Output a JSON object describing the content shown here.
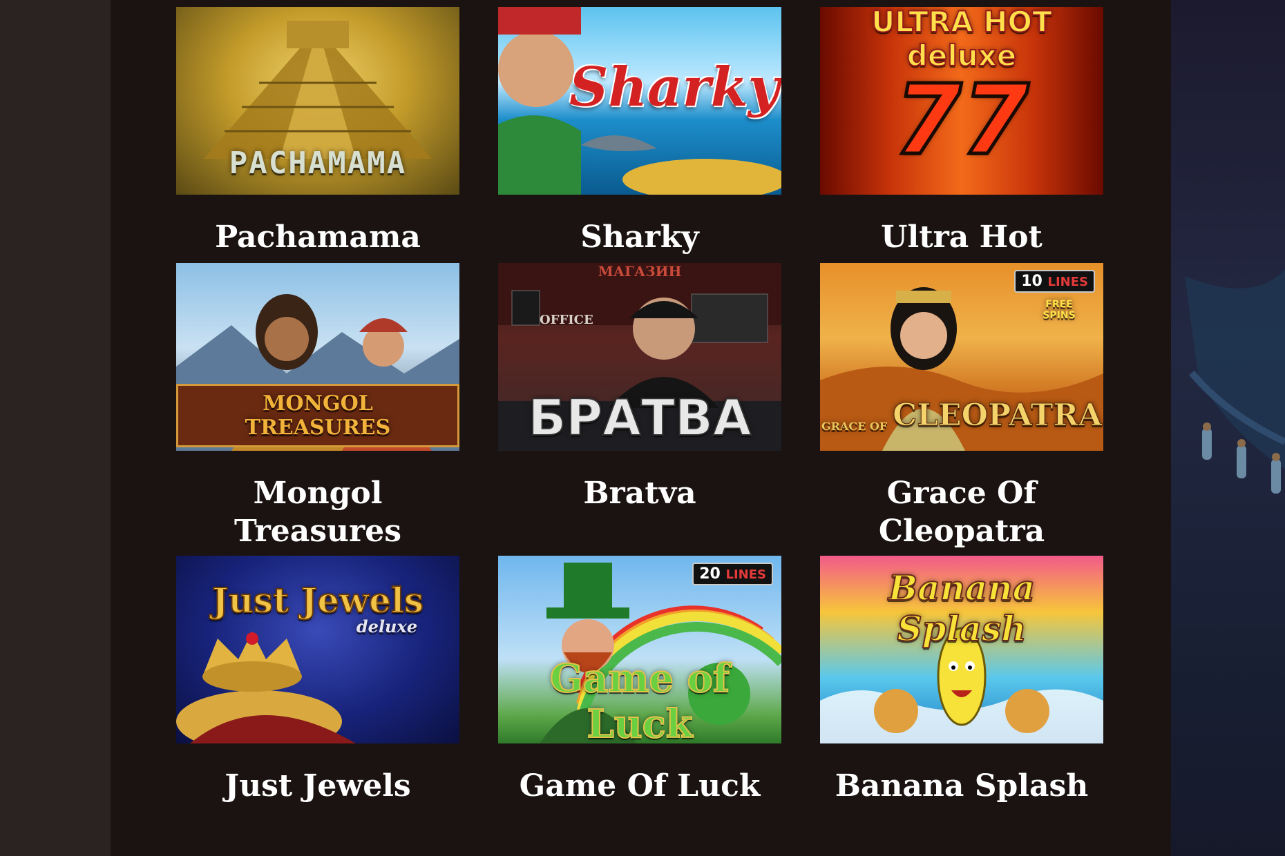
{
  "games": [
    {
      "title": "Pachamama",
      "logo": "PACHAMAMA",
      "theme": "pyramid"
    },
    {
      "title": "Sharky",
      "logo": "Sharky",
      "theme": "sea"
    },
    {
      "title": "Ultra Hot",
      "logo": "ULTRA HOT deluxe",
      "logo_sub": "77",
      "theme": "fire"
    },
    {
      "title": "Mongol Treasures",
      "logo": "MONGOL TREASURES",
      "theme": "mountains"
    },
    {
      "title": "Bratva",
      "logo": "БРАТВА",
      "theme": "street",
      "sign": "МАГАЗИН",
      "office": "OFFICE"
    },
    {
      "title": "Grace Of Cleopatra",
      "logo": "CLEOPATRA",
      "logo_pre": "GRACE OF",
      "theme": "desert",
      "badge_num": "10",
      "badge_word": "LINES",
      "free_spins": "FREE SPINS"
    },
    {
      "title": "Just Jewels",
      "logo": "Just Jewels",
      "logo_sub": "deluxe",
      "theme": "royal"
    },
    {
      "title": "Game Of Luck",
      "logo": "Game of Luck",
      "theme": "rainbow",
      "badge_num": "20",
      "badge_word": "LINES"
    },
    {
      "title": "Banana Splash",
      "logo": "Banana Splash",
      "theme": "splash"
    }
  ],
  "colors": {
    "panel": "#1a1312",
    "page": "#2a2120",
    "title_text": "#ffffff"
  },
  "icons": [
    "curtain-decoration"
  ]
}
